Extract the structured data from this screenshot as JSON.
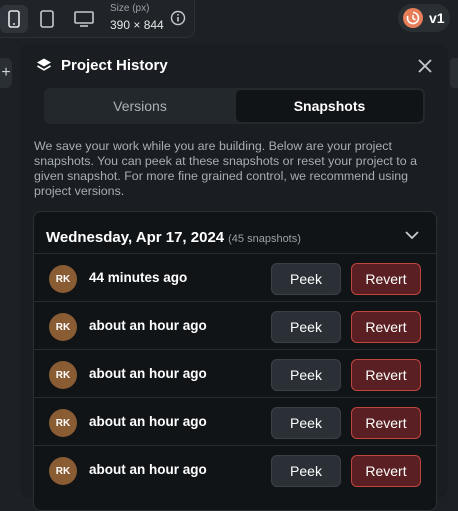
{
  "toolbar": {
    "size_label": "Size (px)",
    "size_value": "390 × 844",
    "version_label": "v1",
    "devices": [
      "mobile-icon",
      "tablet-icon",
      "desktop-icon"
    ]
  },
  "panel": {
    "title": "Project History",
    "tabs": [
      {
        "label": "Versions",
        "active": false
      },
      {
        "label": "Snapshots",
        "active": true
      }
    ],
    "description": "We save your work while you are building. Below are your project snapshots. You can peek at these snapshots or reset your project to a given snapshot. For more fine grained control, we recommend using project versions.",
    "group": {
      "date": "Wednesday, Apr 17, 2024",
      "count": "(45 snapshots)",
      "snapshots": [
        {
          "initials": "RK",
          "time": "44 minutes ago",
          "peek": "Peek",
          "revert": "Revert"
        },
        {
          "initials": "RK",
          "time": "about an hour ago",
          "peek": "Peek",
          "revert": "Revert"
        },
        {
          "initials": "RK",
          "time": "about an hour ago",
          "peek": "Peek",
          "revert": "Revert"
        },
        {
          "initials": "RK",
          "time": "about an hour ago",
          "peek": "Peek",
          "revert": "Revert"
        },
        {
          "initials": "RK",
          "time": "about an hour ago",
          "peek": "Peek",
          "revert": "Revert"
        }
      ]
    }
  },
  "colors": {
    "background": "#1d2125",
    "panel": "#1a1e22",
    "revert_border": "#c0453f",
    "revert_fill": "#5a1f22",
    "avatar": "#8a5c34",
    "version_badge": "#e67e5a"
  }
}
